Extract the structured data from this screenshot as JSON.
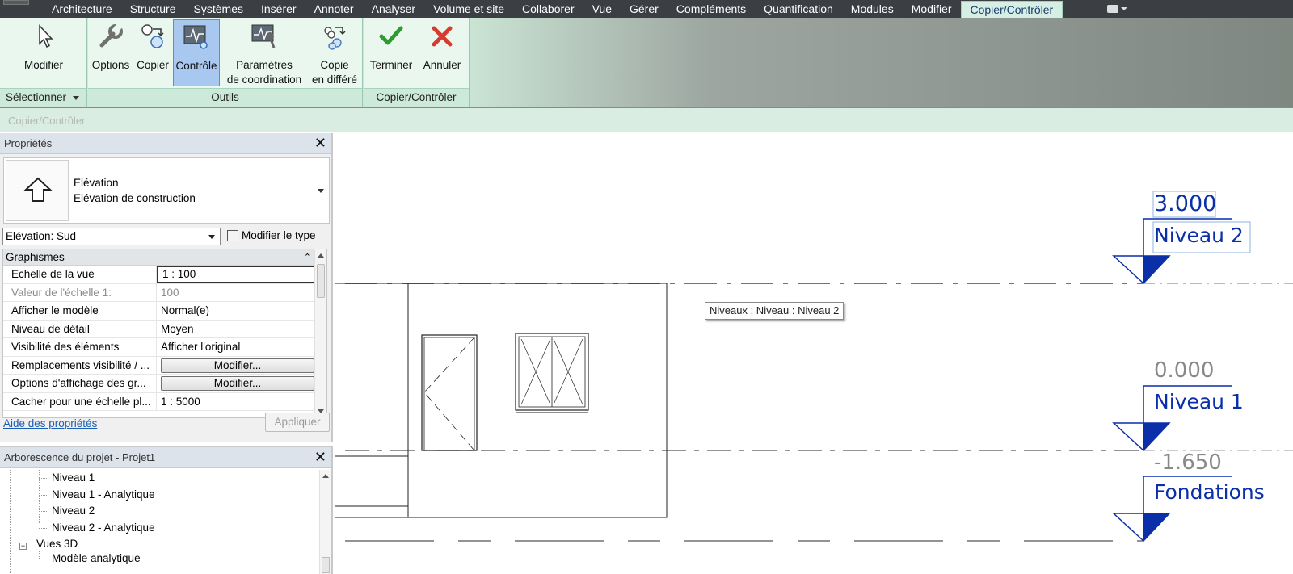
{
  "menu": {
    "tabs": [
      "Architecture",
      "Structure",
      "Systèmes",
      "Insérer",
      "Annoter",
      "Analyser",
      "Volume et site",
      "Collaborer",
      "Vue",
      "Gérer",
      "Compléments",
      "Quantification",
      "Modules",
      "Modifier",
      "Copier/Contrôler"
    ],
    "active_tab": "Copier/Contrôler"
  },
  "ribbon": {
    "modify": "Modifier",
    "options": "Options",
    "copy": "Copier",
    "monitor": "Contrôle",
    "coord_settings_line1": "Paramètres",
    "coord_settings_line2": "de coordination",
    "batch_copy_line1": "Copie",
    "batch_copy_line2": "en différé",
    "finish": "Terminer",
    "cancel": "Annuler",
    "panel_select": "Sélectionner",
    "panel_tools": "Outils",
    "panel_copymonitor": "Copier/Contrôler"
  },
  "context_strip": "Copier/Contrôler",
  "properties": {
    "title": "Propriétés",
    "family": "Elévation",
    "type": "Elévation de construction",
    "view_selector": "Elévation: Sud",
    "edit_type": "Modifier le type",
    "group": "Graphismes",
    "rows": [
      {
        "key": "Echelle de la vue",
        "value": "1 : 100"
      },
      {
        "key": "Valeur de l'échelle    1:",
        "value": "100"
      },
      {
        "key": "Afficher le modèle",
        "value": "Normal(e)"
      },
      {
        "key": "Niveau de détail",
        "value": "Moyen"
      },
      {
        "key": "Visibilité des éléments",
        "value": "Afficher l'original"
      },
      {
        "key": "Remplacements visibilité / ...",
        "value": "Modifier..."
      },
      {
        "key": "Options d'affichage des gr...",
        "value": "Modifier..."
      },
      {
        "key": "Cacher pour une échelle pl...",
        "value": "1 : 5000"
      }
    ],
    "help_link": "Aide des propriétés",
    "apply": "Appliquer"
  },
  "browser": {
    "title": "Arborescence du projet - Projet1",
    "items": [
      "Niveau 1",
      "Niveau 1 - Analytique",
      "Niveau 2",
      "Niveau 2 - Analytique",
      "Vues 3D",
      "Modèle analytique"
    ]
  },
  "canvas": {
    "levels": [
      {
        "elevation": "3.000",
        "name": "Niveau 2"
      },
      {
        "elevation": "0.000",
        "name": "Niveau 1"
      },
      {
        "elevation": "-1.650",
        "name": "Fondations"
      }
    ],
    "tooltip": "Niveaux : Niveau : Niveau 2"
  },
  "colors": {
    "level_blue": "#0a2fa8",
    "selected_blue": "#3a7be0",
    "ribbon_green": "#e9f7ef"
  }
}
